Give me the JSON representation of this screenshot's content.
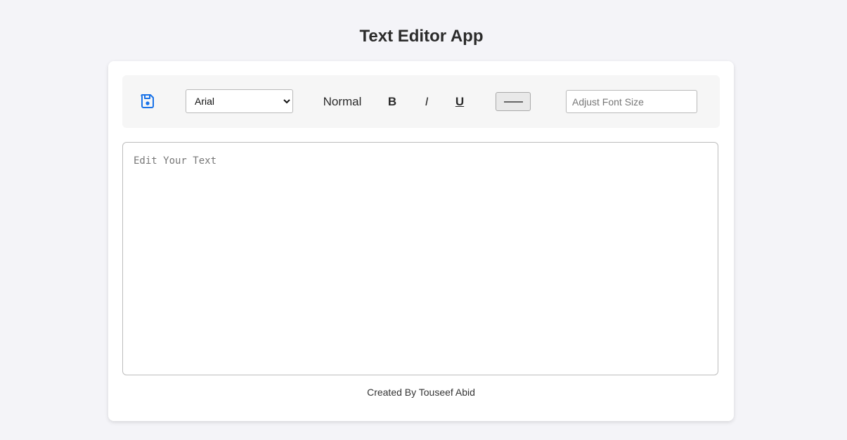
{
  "app": {
    "title": "Text Editor App"
  },
  "toolbar": {
    "save_icon": "floppy-disk-icon",
    "save_icon_color": "#1a73e8",
    "font_select": {
      "selected": "Arial",
      "options": [
        "Arial"
      ]
    },
    "normal_label": "Normal",
    "bold_label": "B",
    "italic_label": "I",
    "underline_label": "U",
    "color_swatch": "#666666",
    "font_size_placeholder": "Adjust Font Size",
    "font_size_value": ""
  },
  "editor": {
    "placeholder": "Edit Your Text",
    "value": ""
  },
  "footer": {
    "credit": "Created By Touseef Abid"
  }
}
